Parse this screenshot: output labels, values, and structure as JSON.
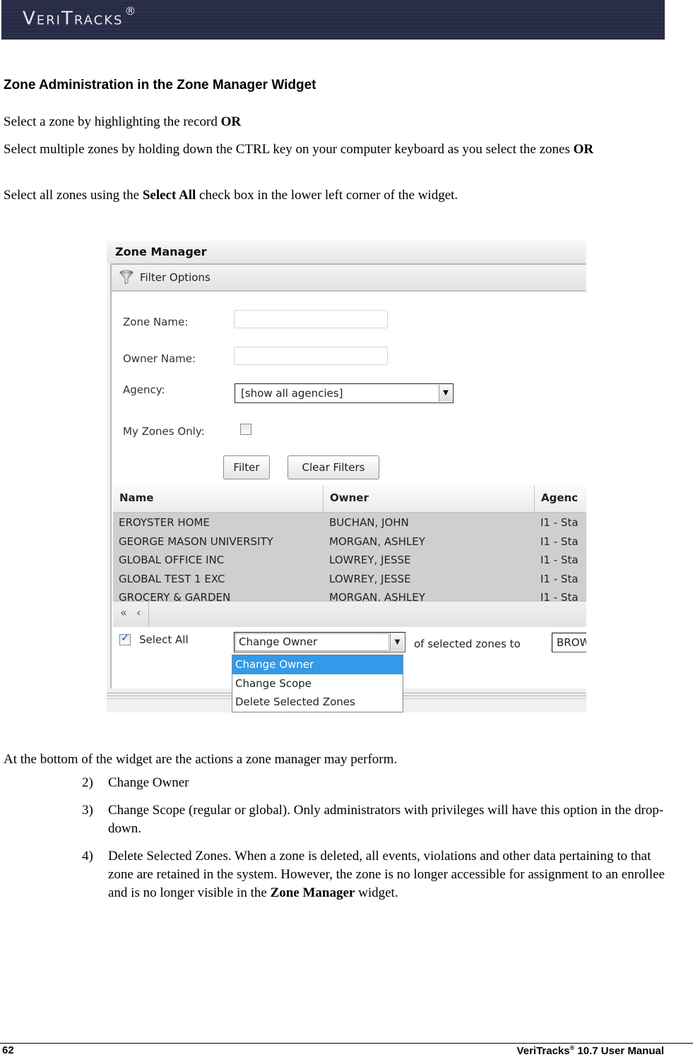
{
  "banner": {
    "logo": "VeriTracks",
    "logo_mark": "®"
  },
  "document": {
    "heading": "Zone Administration in the Zone Manager Widget",
    "paragraphs": {
      "p1_text": "Select a zone by highlighting the record ",
      "p1_bold": "OR",
      "p2_text": "Select multiple zones by holding down the CTRL key on your computer keyboard as you select the zones ",
      "p2_bold": "OR",
      "p3_pre": "Select all zones using the ",
      "p3_bold": "Select All",
      "p3_post": " check box in the lower left corner of the widget.",
      "p4_text": "At the bottom of the widget are the actions a zone manager may perform."
    },
    "actions": [
      {
        "num": "2)",
        "text": "Change Owner"
      },
      {
        "num": "3)",
        "text": "Change Scope (regular or global). Only administrators with privileges will have this option in the drop-down."
      },
      {
        "num": "4)",
        "text_pre": "Delete Selected Zones. When a zone is deleted, all events, violations and other data pertaining to that zone are retained in the system.  However, the zone is no longer accessible for assignment to an enrollee and is no longer visible in the ",
        "text_bold": "Zone Manager",
        "text_post": " widget."
      }
    ]
  },
  "widget": {
    "title": "Zone Manager",
    "filter_options_label": "Filter Options",
    "filter_icon": "funnel-icon",
    "form": {
      "zone_name_label": "Zone Name:",
      "zone_name_value": "",
      "owner_name_label": "Owner Name:",
      "owner_name_value": "",
      "agency_label": "Agency:",
      "agency_selected": "[show all agencies]",
      "my_zones_label": "My Zones Only:",
      "my_zones_checked": false,
      "filter_button": "Filter",
      "clear_filters_button": "Clear Filters"
    },
    "grid": {
      "columns": [
        "Name",
        "Owner",
        "Agenc"
      ],
      "rows": [
        {
          "name": "EROYSTER HOME",
          "owner": "BUCHAN, JOHN",
          "agency": "I1 - Sta"
        },
        {
          "name": "GEORGE MASON UNIVERSITY",
          "owner": "MORGAN, ASHLEY",
          "agency": "I1 - Sta"
        },
        {
          "name": "GLOBAL OFFICE INC",
          "owner": "LOWREY, JESSE",
          "agency": "I1 - Sta"
        },
        {
          "name": "GLOBAL TEST 1 EXC",
          "owner": "LOWREY, JESSE",
          "agency": "I1 - Sta"
        },
        {
          "name": "GROCERY & GARDEN",
          "owner": "MORGAN, ASHLEY",
          "agency": "I1 - Sta"
        }
      ]
    },
    "pager": {
      "first_icon": "«",
      "prev_icon": "‹"
    },
    "actions_bar": {
      "select_all_label": "Select All",
      "select_all_checked": true,
      "action_selected": "Change Owner",
      "of_selected_text": "of selected zones to",
      "owner_value": "BROW",
      "options": [
        "Change Owner",
        "Change Scope",
        "Delete Selected Zones"
      ],
      "highlighted_option": "Change Owner"
    },
    "colors": {
      "highlight": "#3399e8",
      "row_selected_bg": "#cfcfcf"
    }
  },
  "footer": {
    "page_number": "62",
    "manual_title": "VeriTracks",
    "manual_mark": "®",
    "manual_version": " 10.7 User Manual"
  }
}
